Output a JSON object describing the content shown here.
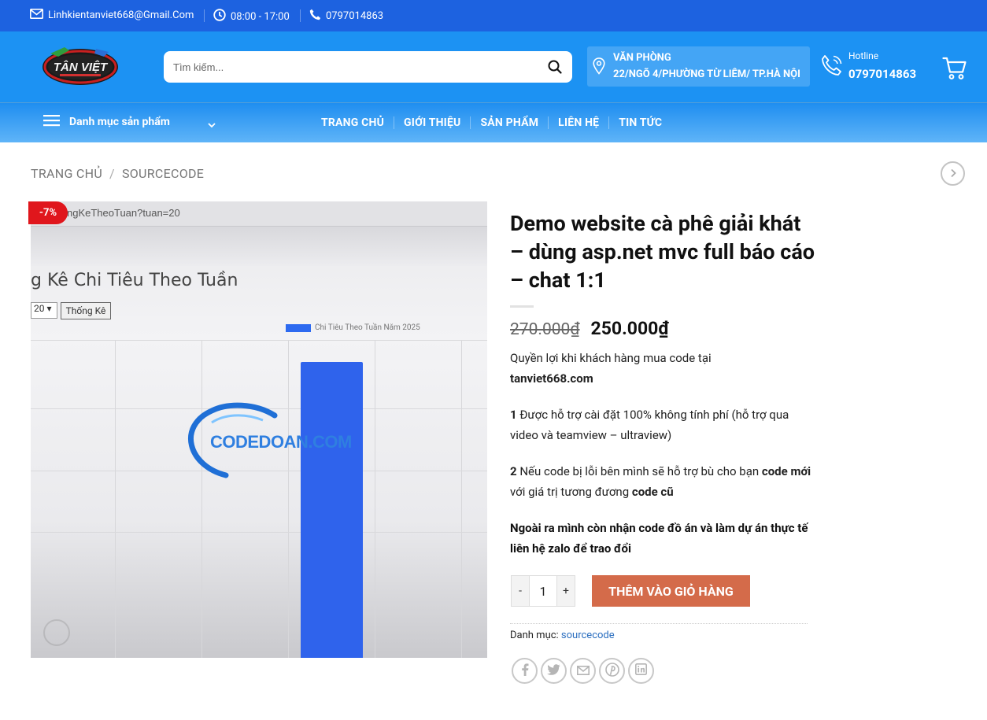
{
  "topbar": {
    "email": "Linhkientanviet668@Gmail.Com",
    "hours": "08:00 - 17:00",
    "phone": "0797014863"
  },
  "header": {
    "logo_text": "TÂN VIỆT",
    "search_placeholder": "Tìm kiếm...",
    "office_label": "VĂN PHÒNG",
    "office_address": "22/NGÕ 4/PHƯỜNG TỪ LIÊM/ TP.HÀ NỘI",
    "hotline_label": "Hotline",
    "hotline_number": "0797014863"
  },
  "nav": {
    "categories_label": "Danh mục sản phẩm",
    "items": [
      "TRANG CHỦ",
      "GIỚI THIỆU",
      "SẢN PHẨM",
      "LIÊN HỆ",
      "TIN TỨC"
    ]
  },
  "breadcrumb": {
    "home": "TRANG CHỦ",
    "sep": "/",
    "current": "SOURCECODE"
  },
  "product": {
    "badge": "-7%",
    "image": {
      "url_text": "ngKeTheoTuan?tuan=20",
      "heading": "g Kê Chi Tiêu Theo Tuần",
      "select_value": "20",
      "button": "Thống Kê",
      "legend": "Chi Tiêu Theo Tuần Năm 2025",
      "watermark": "CODEDOAN.COM"
    },
    "title": "Demo website cà phê giải khát – dùng asp.net mvc full báo cáo – chat 1:1",
    "old_price": "270.000₫",
    "new_price": "250.000₫",
    "desc": {
      "intro_1": "Quyền lợi khi khách hàng mua code tại",
      "intro_site": "tanviet668.com",
      "p1_num": "1",
      "p1_text": " Được hỗ trợ cài đặt 100% không tính phí (hỗ trợ qua video và teamview – ultraview)",
      "p2_num": "2",
      "p2_a": " Nếu code bị lỗi bên mình sẽ hỗ trợ bù cho bạn ",
      "p2_b": "code mới",
      "p2_c": " với giá trị tương đương ",
      "p2_d": "code cũ",
      "p3": "Ngoài ra mình còn nhận code đồ án và làm dự án thực tế liên hệ zalo để trao đổi"
    },
    "qty_minus": "-",
    "qty_value": "1",
    "qty_plus": "+",
    "add_to_cart": "THÊM VÀO GIỎ HÀNG",
    "category_label": "Danh mục:",
    "category_value": "sourcecode"
  }
}
